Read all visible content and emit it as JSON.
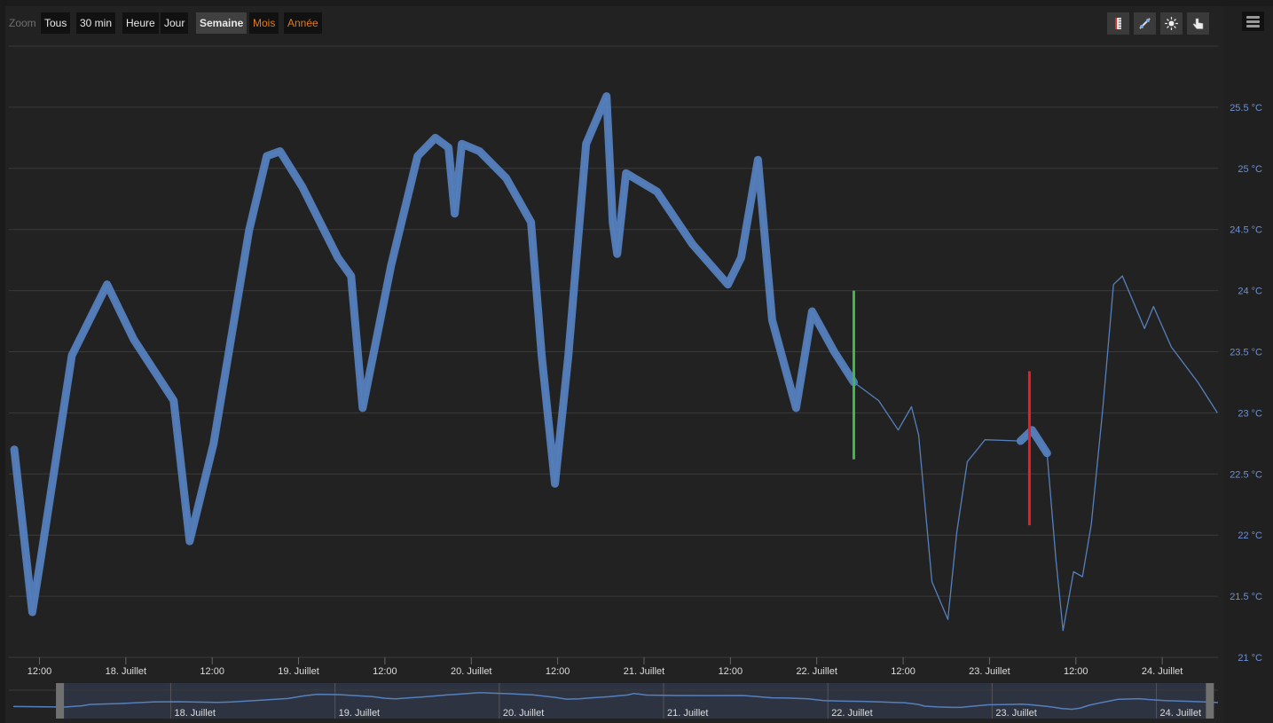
{
  "range_selector": {
    "label": "Zoom",
    "buttons": [
      {
        "label": "Tous",
        "state": "normal"
      },
      {
        "label": "30 min",
        "state": "normal"
      },
      {
        "label": "Heure",
        "state": "normal"
      },
      {
        "label": "Jour",
        "state": "normal"
      },
      {
        "label": "Semaine",
        "state": "selected"
      },
      {
        "label": "Mois",
        "state": "disabled"
      },
      {
        "label": "Année",
        "state": "disabled"
      }
    ]
  },
  "toolbar": {
    "icons": [
      "ruler-icon",
      "line-tool-icon",
      "sun-icon",
      "pointer-hand-icon"
    ],
    "menu_icon": "hamburger-menu-icon"
  },
  "colors": {
    "series": "#5580bd",
    "green_marker": "#3fb94a",
    "red_marker": "#ee1c25",
    "navigator_mask": "#2d3340",
    "handle": "#707070"
  },
  "chart_data": {
    "type": "line",
    "title": "",
    "ylabel": "",
    "y_unit": "°C",
    "ylim": [
      21,
      26
    ],
    "yticks": [
      "21 °C",
      "21.5 °C",
      "22 °C",
      "22.5 °C",
      "23 °C",
      "23.5 °C",
      "24 °C",
      "24.5 °C",
      "25 °C",
      "25.5 °C"
    ],
    "xlim": [
      "17/07 07:45",
      "24/07 07:45"
    ],
    "xticks": [
      "12:00",
      "18. Juillet",
      "12:00",
      "19. Juillet",
      "12:00",
      "20. Juillet",
      "12:00",
      "21. Juillet",
      "12:00",
      "22. Juillet",
      "12:00",
      "23. Juillet",
      "12:00",
      "24. Juillet"
    ],
    "grid": true,
    "series": [
      {
        "points": [
          [
            "17/07 08:30",
            22.7
          ],
          [
            "17/07 11:00",
            21.37
          ],
          [
            "17/07 12:10",
            21.8
          ],
          [
            "17/07 16:30",
            23.47
          ],
          [
            "17/07 21:24",
            24.05
          ],
          [
            "18/07 01:06",
            23.6
          ],
          [
            "18/07 06:39",
            23.1
          ],
          [
            "18/07 08:52",
            21.95
          ],
          [
            "18/07 12:12",
            22.75
          ],
          [
            "18/07 17:07",
            24.49
          ],
          [
            "18/07 19:35",
            25.1
          ],
          [
            "18/07 21:26",
            25.14
          ],
          [
            "19/07 00:31",
            24.85
          ],
          [
            "19/07 05:27",
            24.27
          ],
          [
            "19/07 07:18",
            24.12
          ],
          [
            "19/07 08:54",
            23.04
          ],
          [
            "19/07 10:22",
            23.47
          ],
          [
            "19/07 12:50",
            24.2
          ],
          [
            "19/07 16:32",
            25.1
          ],
          [
            "19/07 19:00",
            25.25
          ],
          [
            "19/07 20:50",
            25.17
          ],
          [
            "19/07 21:42",
            24.63
          ],
          [
            "19/07 22:41",
            25.2
          ],
          [
            "20/07 01:09",
            25.14
          ],
          [
            "20/07 04:51",
            24.92
          ],
          [
            "20/07 08:18",
            24.56
          ],
          [
            "20/07 09:47",
            23.47
          ],
          [
            "20/07 11:38",
            22.42
          ],
          [
            "20/07 13:29",
            23.47
          ],
          [
            "20/07 15:57",
            25.2
          ],
          [
            "20/07 18:47",
            25.59
          ],
          [
            "20/07 19:39",
            24.56
          ],
          [
            "20/07 20:16",
            24.3
          ],
          [
            "20/07 21:30",
            24.96
          ],
          [
            "21/07 01:48",
            24.81
          ],
          [
            "21/07 06:43",
            24.38
          ],
          [
            "21/07 11:39",
            24.05
          ],
          [
            "21/07 13:30",
            24.27
          ],
          [
            "21/07 15:50",
            25.07
          ],
          [
            "21/07 17:48",
            23.76
          ],
          [
            "21/07 21:08",
            23.04
          ],
          [
            "21/07 23:21",
            23.83
          ],
          [
            "22/07 02:26",
            23.5
          ],
          [
            "22/07 05:09",
            23.25
          ],
          [
            "22/07 08:36",
            23.1
          ],
          [
            "22/07 11:19",
            22.86
          ],
          [
            "22/07 13:10",
            23.05
          ],
          [
            "22/07 14:09",
            22.82
          ],
          [
            "22/07 16:00",
            21.62
          ],
          [
            "22/07 18:13",
            21.31
          ],
          [
            "22/07 19:27",
            22.02
          ],
          [
            "22/07 20:55",
            22.6
          ],
          [
            "22/07 23:23",
            22.78
          ],
          [
            "23/07 04:19",
            22.77
          ],
          [
            "23/07 05:55",
            22.86
          ],
          [
            "23/07 08:00",
            22.67
          ],
          [
            "23/07 09:14",
            21.8
          ],
          [
            "23/07 10:13",
            21.22
          ],
          [
            "23/07 11:41",
            21.7
          ],
          [
            "23/07 12:55",
            21.66
          ],
          [
            "23/07 14:09",
            22.09
          ],
          [
            "23/07 15:45",
            23.04
          ],
          [
            "23/07 17:14",
            24.05
          ],
          [
            "23/07 18:28",
            24.12
          ],
          [
            "23/07 21:33",
            23.69
          ],
          [
            "23/07 22:47",
            23.87
          ],
          [
            "24/07 01:15",
            23.54
          ],
          [
            "24/07 04:57",
            23.25
          ],
          [
            "24/07 07:40",
            23.0
          ]
        ],
        "noisy_ranges": [
          [
            "17/07 08:30",
            "22/07 05:09"
          ],
          [
            "23/07 04:19",
            "23/07 08:00"
          ]
        ]
      }
    ],
    "plot_lines": [
      {
        "x": "22/07 05:09",
        "from": 22.62,
        "to": 24.0,
        "color": "green"
      },
      {
        "x": "23/07 05:33",
        "from": 22.08,
        "to": 23.34,
        "color": "red"
      }
    ],
    "navigator": {
      "xlim": [
        "17/07 01:00",
        "24/07 09:00"
      ],
      "selected": [
        "17/07 07:45",
        "24/07 07:45"
      ],
      "labels": [
        "18. Juillet",
        "19. Juillet",
        "20. Juillet",
        "21. Juillet",
        "22. Juillet",
        "23. Juillet",
        "24. Juillet"
      ]
    }
  }
}
